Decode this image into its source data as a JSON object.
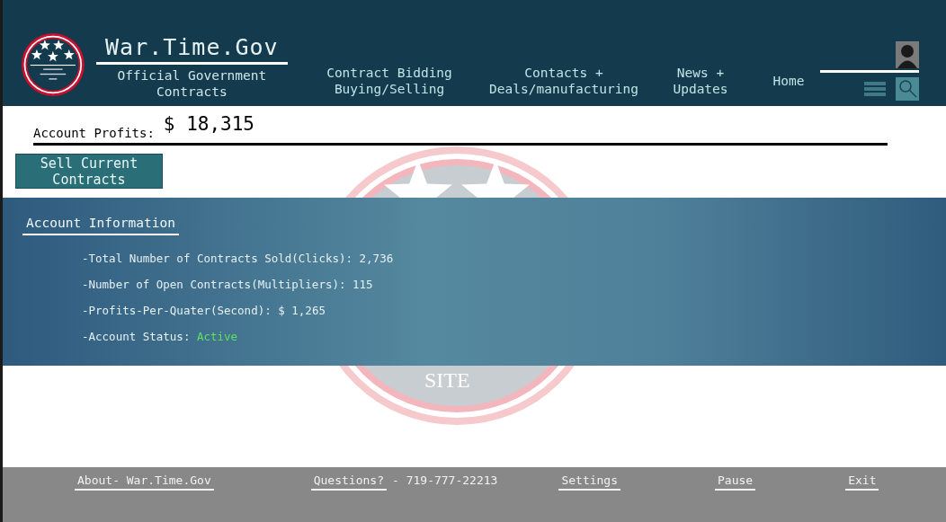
{
  "header": {
    "title": "War.Time.Gov",
    "subtitle": "Official Government Contracts",
    "nav": [
      {
        "label": "Contract Bidding Buying/Selling"
      },
      {
        "label": "Contacts + Deals/manufacturing"
      },
      {
        "label": "News + Updates"
      },
      {
        "label": "Home"
      }
    ]
  },
  "profits": {
    "label": "Account Profits:",
    "value": "$ 18,315"
  },
  "sell_button": "Sell Current Contracts",
  "emblem_text": "SITE",
  "account": {
    "title": "Account Information",
    "lines": [
      {
        "label": "-Total Number of Contracts Sold(Clicks):",
        "value": "2,736",
        "kind": "plain"
      },
      {
        "label": "-Number of Open Contracts(Multipliers):",
        "value": "115",
        "kind": "plain"
      },
      {
        "label": "-Profits-Per-Quater(Second):",
        "value": "$ 1,265",
        "kind": "plain"
      },
      {
        "label": "-Account Status:",
        "value": "Active",
        "kind": "status"
      }
    ]
  },
  "footer": [
    {
      "label": "About- War.Time.Gov"
    },
    {
      "label": "Questions?",
      "note": "- 719-777-22213"
    },
    {
      "label": "Settings"
    },
    {
      "label": "Pause"
    },
    {
      "label": "Exit"
    }
  ]
}
